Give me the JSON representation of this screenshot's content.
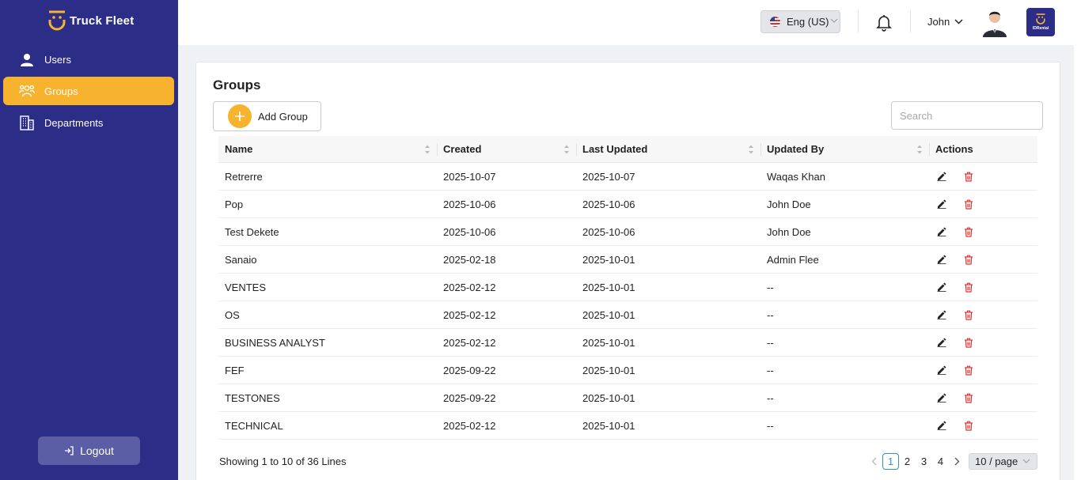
{
  "brand": {
    "name": "Truck Fleet"
  },
  "sidebar": {
    "items": [
      {
        "label": "Users",
        "icon": "user-icon",
        "active": false
      },
      {
        "label": "Groups",
        "icon": "groups-icon",
        "active": true
      },
      {
        "label": "Departments",
        "icon": "building-icon",
        "active": false
      }
    ],
    "logout_label": "Logout"
  },
  "topbar": {
    "language": "Eng (US)",
    "user_name": "John",
    "app_logo_text": "IDRental"
  },
  "page": {
    "title": "Groups",
    "add_button_label": "Add Group",
    "search_placeholder": "Search"
  },
  "table": {
    "columns": [
      "Name",
      "Created",
      "Last Updated",
      "Updated By",
      "Actions"
    ],
    "rows": [
      {
        "name": "Retrerre",
        "created": "2025-10-07",
        "updated": "2025-10-07",
        "updated_by": "Waqas Khan"
      },
      {
        "name": "Pop",
        "created": "2025-10-06",
        "updated": "2025-10-06",
        "updated_by": "John Doe"
      },
      {
        "name": "Test Dekete",
        "created": "2025-10-06",
        "updated": "2025-10-06",
        "updated_by": "John Doe"
      },
      {
        "name": "Sanaio",
        "created": "2025-02-18",
        "updated": "2025-10-01",
        "updated_by": "Admin Flee"
      },
      {
        "name": "VENTES",
        "created": "2025-02-12",
        "updated": "2025-10-01",
        "updated_by": "--"
      },
      {
        "name": "OS",
        "created": "2025-02-12",
        "updated": "2025-10-01",
        "updated_by": "--"
      },
      {
        "name": "BUSINESS ANALYST",
        "created": "2025-02-12",
        "updated": "2025-10-01",
        "updated_by": "--"
      },
      {
        "name": "FEF",
        "created": "2025-09-22",
        "updated": "2025-10-01",
        "updated_by": "--"
      },
      {
        "name": "TESTONES",
        "created": "2025-09-22",
        "updated": "2025-10-01",
        "updated_by": "--"
      },
      {
        "name": "TECHNICAL",
        "created": "2025-02-12",
        "updated": "2025-10-01",
        "updated_by": "--"
      }
    ]
  },
  "footer": {
    "showing_text": "Showing 1 to 10 of 36 Lines",
    "pages": [
      "1",
      "2",
      "3",
      "4"
    ],
    "current_page": "1",
    "page_size": "10 / page"
  },
  "colors": {
    "sidebar": "#2b2d86",
    "accent": "#f7b22e",
    "delete": "#e03131",
    "pager_active": "#2f8fd8"
  }
}
